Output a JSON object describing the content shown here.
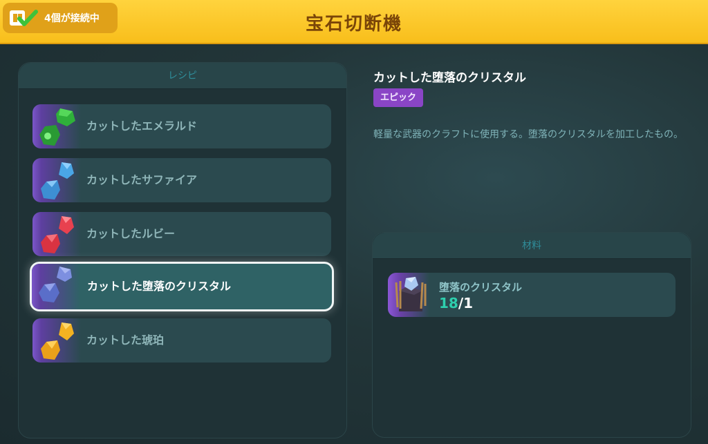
{
  "header": {
    "title": "宝石切断機",
    "connection_text": "4個が接続中",
    "connection_icon": "network-check-icon"
  },
  "recipes": {
    "title": "レシピ",
    "items": [
      {
        "label": "カットしたエメラルド",
        "icon": "emerald-gem-icon",
        "color": "#2fb03a"
      },
      {
        "label": "カットしたサファイア",
        "icon": "sapphire-gem-icon",
        "color": "#4aa6e6"
      },
      {
        "label": "カットしたルビー",
        "icon": "ruby-gem-icon",
        "color": "#e8414f"
      },
      {
        "label": "カットした堕落のクリスタル",
        "icon": "fallen-crystal-gem-icon",
        "color": "#6a7fd6",
        "selected": true
      },
      {
        "label": "カットした琥珀",
        "icon": "amber-gem-icon",
        "color": "#f4b221"
      }
    ]
  },
  "detail": {
    "name": "カットした堕落のクリスタル",
    "rarity": "エピック",
    "rarity_color": "#8a45c6",
    "description": "軽量な武器のクラフトに使用する。堕落のクリスタルを加工したもの。"
  },
  "materials": {
    "title": "材料",
    "items": [
      {
        "name": "堕落のクリスタル",
        "have": "18",
        "need": "/1",
        "icon": "fallen-crystal-ore-icon"
      }
    ]
  }
}
